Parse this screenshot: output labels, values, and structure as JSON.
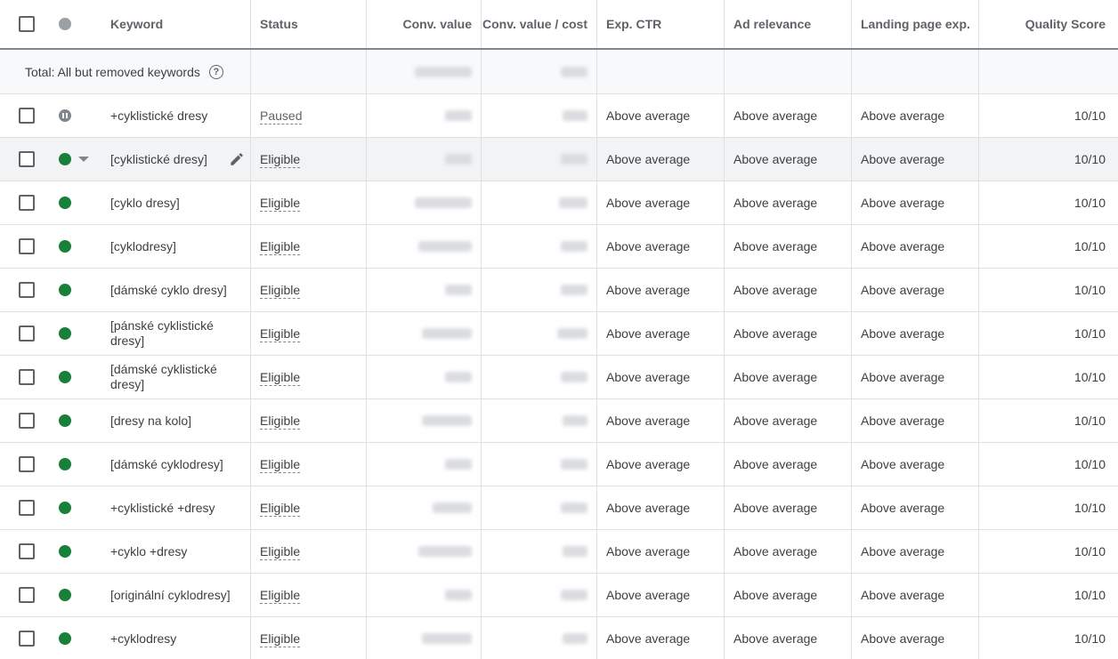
{
  "header": {
    "keyword": "Keyword",
    "status": "Status",
    "conv_value": "Conv. value",
    "conv_value_cost": "Conv. value / cost",
    "exp_ctr": "Exp. CTR",
    "ad_relevance": "Ad relevance",
    "landing_page": "Landing page exp.",
    "quality_score": "Quality Score"
  },
  "total": {
    "label": "Total: All but removed keywords",
    "help_icon": "?"
  },
  "rows": [
    {
      "keyword": "+cyklistické dresy",
      "status": "Paused",
      "dot": "paused",
      "ctr": "Above average",
      "relevance": "Above average",
      "landing": "Above average",
      "qs": "10/10"
    },
    {
      "keyword": "[cyklistické dresy]",
      "status": "Eligible",
      "dot": "green",
      "ctr": "Above average",
      "relevance": "Above average",
      "landing": "Above average",
      "qs": "10/10"
    },
    {
      "keyword": "[cyklo dresy]",
      "status": "Eligible",
      "dot": "green",
      "ctr": "Above average",
      "relevance": "Above average",
      "landing": "Above average",
      "qs": "10/10"
    },
    {
      "keyword": "[cyklodresy]",
      "status": "Eligible",
      "dot": "green",
      "ctr": "Above average",
      "relevance": "Above average",
      "landing": "Above average",
      "qs": "10/10"
    },
    {
      "keyword": "[dámské cyklo dresy]",
      "status": "Eligible",
      "dot": "green",
      "ctr": "Above average",
      "relevance": "Above average",
      "landing": "Above average",
      "qs": "10/10"
    },
    {
      "keyword": "[pánské cyklistické dresy]",
      "status": "Eligible",
      "dot": "green",
      "ctr": "Above average",
      "relevance": "Above average",
      "landing": "Above average",
      "qs": "10/10"
    },
    {
      "keyword": "[dámské cyklistické dresy]",
      "status": "Eligible",
      "dot": "green",
      "ctr": "Above average",
      "relevance": "Above average",
      "landing": "Above average",
      "qs": "10/10"
    },
    {
      "keyword": "[dresy na kolo]",
      "status": "Eligible",
      "dot": "green",
      "ctr": "Above average",
      "relevance": "Above average",
      "landing": "Above average",
      "qs": "10/10"
    },
    {
      "keyword": "[dámské cyklodresy]",
      "status": "Eligible",
      "dot": "green",
      "ctr": "Above average",
      "relevance": "Above average",
      "landing": "Above average",
      "qs": "10/10"
    },
    {
      "keyword": "+cyklistické +dresy",
      "status": "Eligible",
      "dot": "green",
      "ctr": "Above average",
      "relevance": "Above average",
      "landing": "Above average",
      "qs": "10/10"
    },
    {
      "keyword": "+cyklo +dresy",
      "status": "Eligible",
      "dot": "green",
      "ctr": "Above average",
      "relevance": "Above average",
      "landing": "Above average",
      "qs": "10/10"
    },
    {
      "keyword": "[originální cyklodresy]",
      "status": "Eligible",
      "dot": "green",
      "ctr": "Above average",
      "relevance": "Above average",
      "landing": "Above average",
      "qs": "10/10"
    },
    {
      "keyword": "+cyklodresy",
      "status": "Eligible",
      "dot": "green",
      "ctr": "Above average",
      "relevance": "Above average",
      "landing": "Above average",
      "qs": "10/10"
    }
  ],
  "colors": {
    "eligible": "#188038",
    "paused": "#80868b",
    "header_border": "#80868b"
  }
}
